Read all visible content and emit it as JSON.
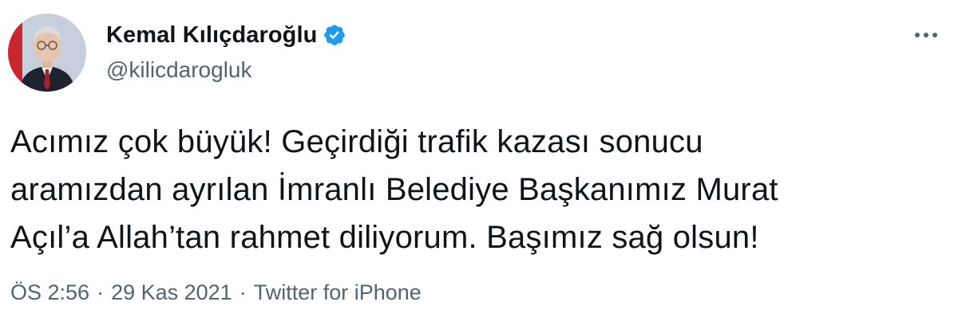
{
  "tweet": {
    "author": {
      "display_name": "Kemal Kılıçdaroğlu",
      "handle": "@kilicdarogluk",
      "verified_icon": "verified-badge-icon"
    },
    "text": "Acımız çok büyük! Geçirdiği trafik kazası sonucu\naramızdan ayrılan İmranlı Belediye Başkanımız Murat\nAçıl’a Allah’tan rahmet diliyorum. Başımız sağ olsun!",
    "time": "ÖS 2:56",
    "date": "29 Kas 2021",
    "separator": "·",
    "source": "Twitter for iPhone",
    "more_icon": "more-horizontal-icon"
  },
  "colors": {
    "text_primary": "#0f1419",
    "text_secondary": "#536471",
    "verified_blue": "#1d9bf0"
  }
}
